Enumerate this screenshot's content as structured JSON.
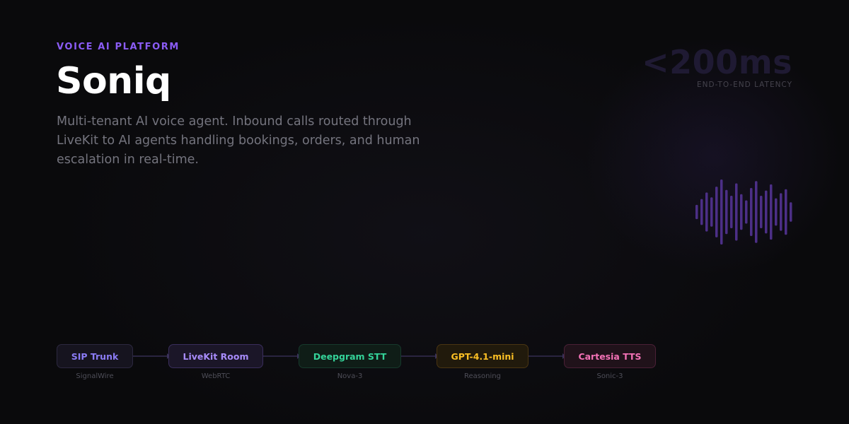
{
  "eyebrow": "VOICE AI PLATFORM",
  "title": "Soniq",
  "description": "Multi-tenant AI voice agent. Inbound calls routed through LiveKit to AI agents handling bookings, orders, and human escalation in real-time.",
  "metric": {
    "value": "<200ms",
    "label": "END-TO-END LATENCY"
  },
  "waveform": {
    "icon": "audio-waveform-icon",
    "color": "#4c2f87",
    "levels": [
      0.22,
      0.4,
      0.6,
      0.45,
      0.78,
      1.0,
      0.68,
      0.5,
      0.88,
      0.55,
      0.36,
      0.74,
      0.95,
      0.5,
      0.66,
      0.85,
      0.42,
      0.58,
      0.7,
      0.3
    ]
  },
  "pipeline": [
    {
      "label": "SIP Trunk",
      "sub": "SignalWire",
      "color": "#8b7cf6",
      "border": "#2c2840",
      "bg": "#16141f"
    },
    {
      "label": "LiveKit Room",
      "sub": "WebRTC",
      "color": "#a78bfa",
      "border": "#3a2e5c",
      "bg": "#1b1628"
    },
    {
      "label": "Deepgram STT",
      "sub": "Nova-3",
      "color": "#34d399",
      "border": "#163a2c",
      "bg": "#0f1d17"
    },
    {
      "label": "GPT-4.1-mini",
      "sub": "Reasoning",
      "color": "#fbbf24",
      "border": "#4a3512",
      "bg": "#211a0c"
    },
    {
      "label": "Cartesia TTS",
      "sub": "Sonic-3",
      "color": "#f472b6",
      "border": "#4a2036",
      "bg": "#20121a"
    }
  ]
}
